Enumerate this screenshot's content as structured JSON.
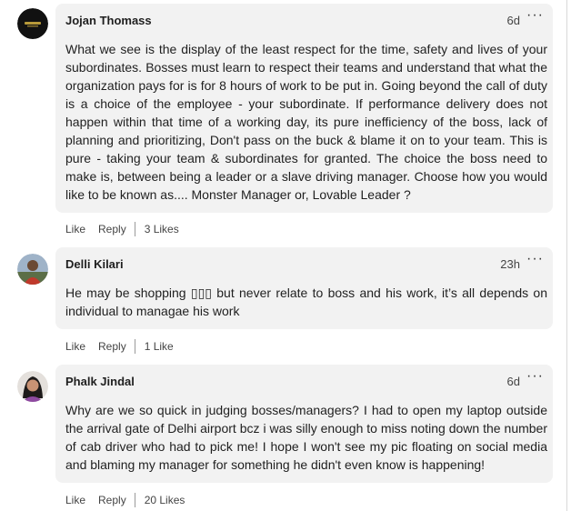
{
  "comments": [
    {
      "author": "Jojan Thomass",
      "time": "6d",
      "more": "···",
      "text": "What we see is the display of the least respect for the time, safety and lives of your subordinates. Bosses must learn to respect their teams and understand that what the organization pays for is for 8 hours of work to be put in. Going beyond the call of duty is a choice of the employee - your subordinate. If performance delivery does not happen within that time of a working day, its pure inefficiency of the boss, lack of planning and prioritizing, Don't pass on the buck & blame it on to your team. This is pure - taking your team & subordinates for granted. The choice the boss need to make is, between being a leader or a slave driving manager. Choose how you would like to be known as.... Monster Manager or, Lovable Leader ?",
      "like_label": "Like",
      "reply_label": "Reply",
      "likes_count": "3 Likes"
    },
    {
      "author": "Delli Kilari",
      "time": "23h",
      "more": "···",
      "text": "He may be shopping ▯▯▯ but never relate to boss and his work, it’s all depends on individual to managae his work",
      "like_label": "Like",
      "reply_label": "Reply",
      "likes_count": "1 Like"
    },
    {
      "author": "Phalk Jindal",
      "time": "6d",
      "more": "···",
      "text": "Why are we so quick in judging bosses/managers? I had to open my laptop outside the arrival gate of Delhi airport bcz i was silly enough to miss noting down the number of cab driver who had to pick me! I hope I won't see my pic floating on social media and blaming my manager for something he didn't even know is happening!",
      "like_label": "Like",
      "reply_label": "Reply",
      "likes_count": "20 Likes"
    }
  ]
}
